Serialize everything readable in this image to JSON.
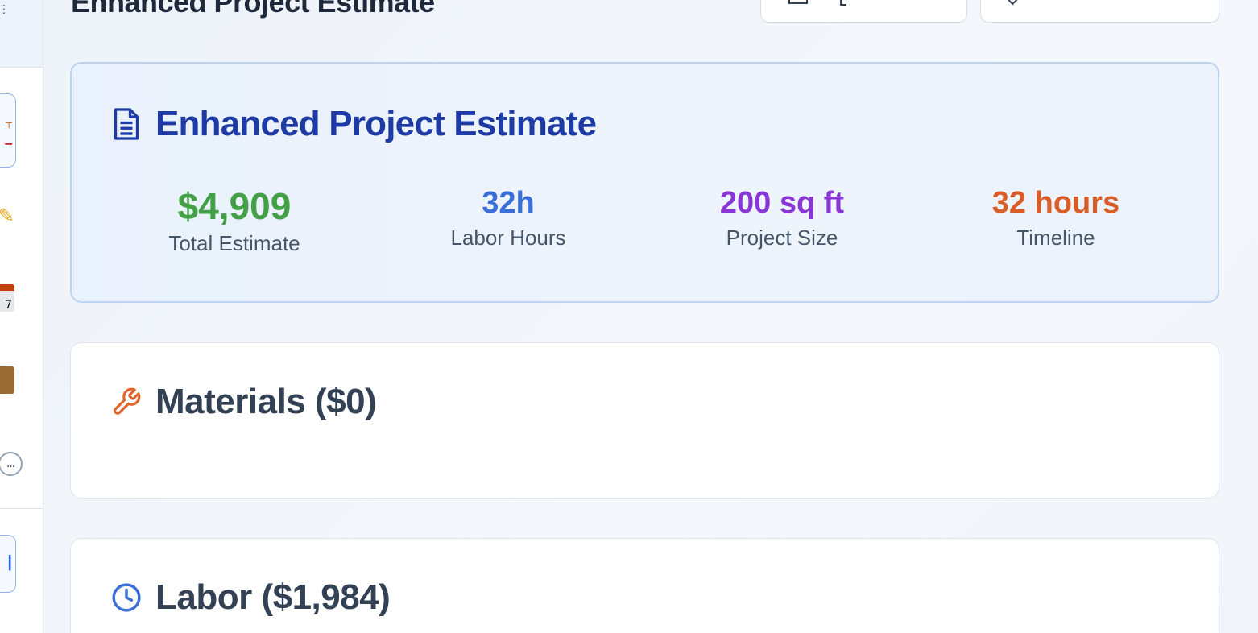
{
  "header": {
    "title": "Enhanced Project Estimate"
  },
  "estimate": {
    "title": "Enhanced Project Estimate",
    "icon": "document-icon",
    "stats": {
      "total": {
        "value": "$4,909",
        "label": "Total Estimate",
        "color": "#43a047"
      },
      "labor_hours": {
        "value": "32h",
        "label": "Labor Hours",
        "color": "#3b6fd8"
      },
      "project_size": {
        "value": "200 sq ft",
        "label": "Project Size",
        "color": "#8a36d6"
      },
      "timeline": {
        "value": "32 hours",
        "label": "Timeline",
        "color": "#d95d27"
      }
    }
  },
  "sections": {
    "materials": {
      "title": "Materials ($0)",
      "icon": "wrench-icon"
    },
    "labor": {
      "title": "Labor ($1,984)",
      "icon": "clock-icon"
    }
  },
  "sidebar": {
    "calendar_day": "7",
    "more_label": "..."
  },
  "colors": {
    "accent": "#1e3aa5",
    "card_border": "#bcd4f1"
  }
}
